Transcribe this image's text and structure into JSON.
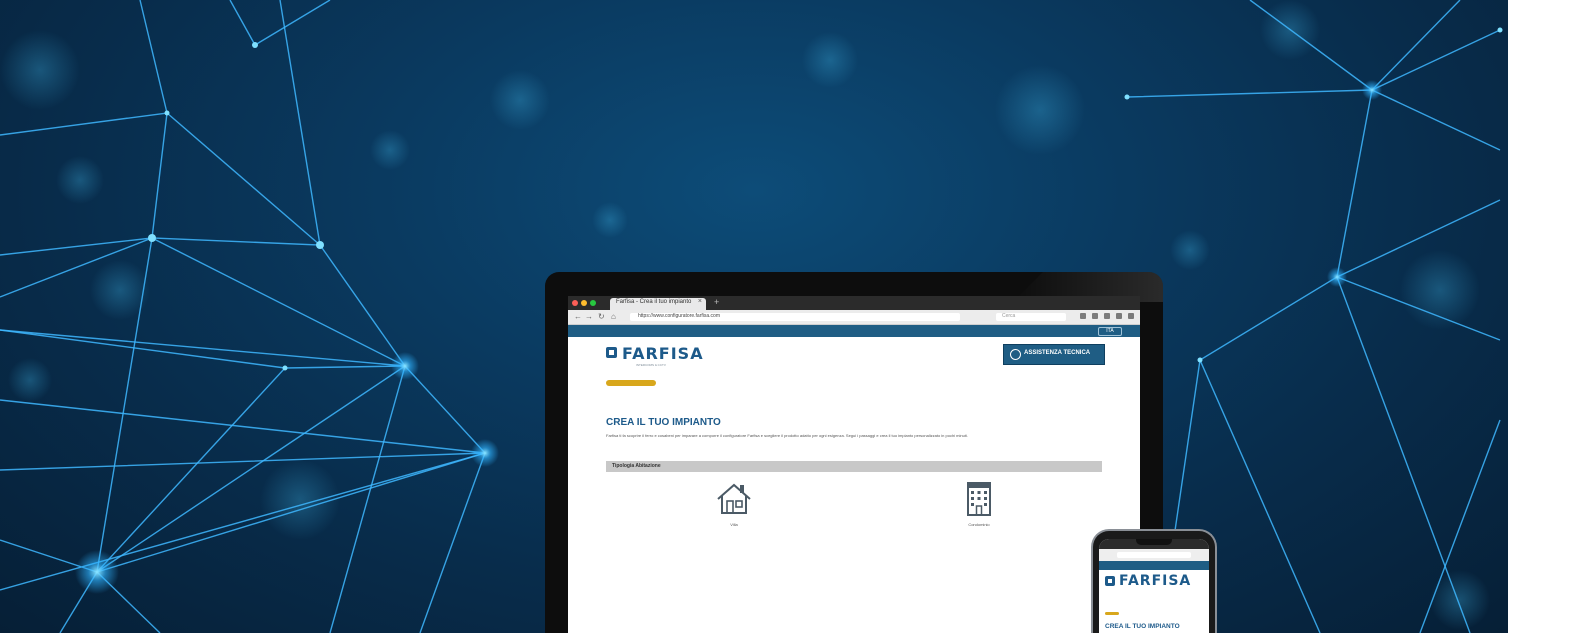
{
  "browser": {
    "tab_title": "Farfisa - Crea il tuo impianto",
    "tab_close": "×",
    "new_tab": "+",
    "url": "https://www.configuratore.farfisa.com",
    "search_placeholder": "Cerca"
  },
  "site": {
    "language_button": "ITA",
    "logo_text": "FARFISA",
    "logo_tagline": "INTERCOMS & CCTV",
    "assist_button": "ASSISTENZA TECNICA",
    "page_title": "CREA IL TUO IMPIANTO",
    "intro": "Farfisa ti fa scoprire il ferro e cosabeni per imparare a comporre il configuratore Farfisa e scegliere il prodotto adatto per ogni esigenza. Segui i passaggi e crea il tuo impianto personalizzato in pochi minuti.",
    "section_label": "Tipologia Abitazione",
    "options": [
      {
        "label": "Villa",
        "icon": "house-icon"
      },
      {
        "label": "Condominio",
        "icon": "apartment-building-icon"
      }
    ]
  },
  "phone": {
    "logo_text": "FARFISA",
    "page_title": "CREA IL TUO IMPIANTO"
  },
  "colors": {
    "brand_blue": "#1d5a8a",
    "accent_gold": "#d8a71c",
    "background_navy": "#082c4b",
    "network_cyan": "#2fb3ff"
  }
}
